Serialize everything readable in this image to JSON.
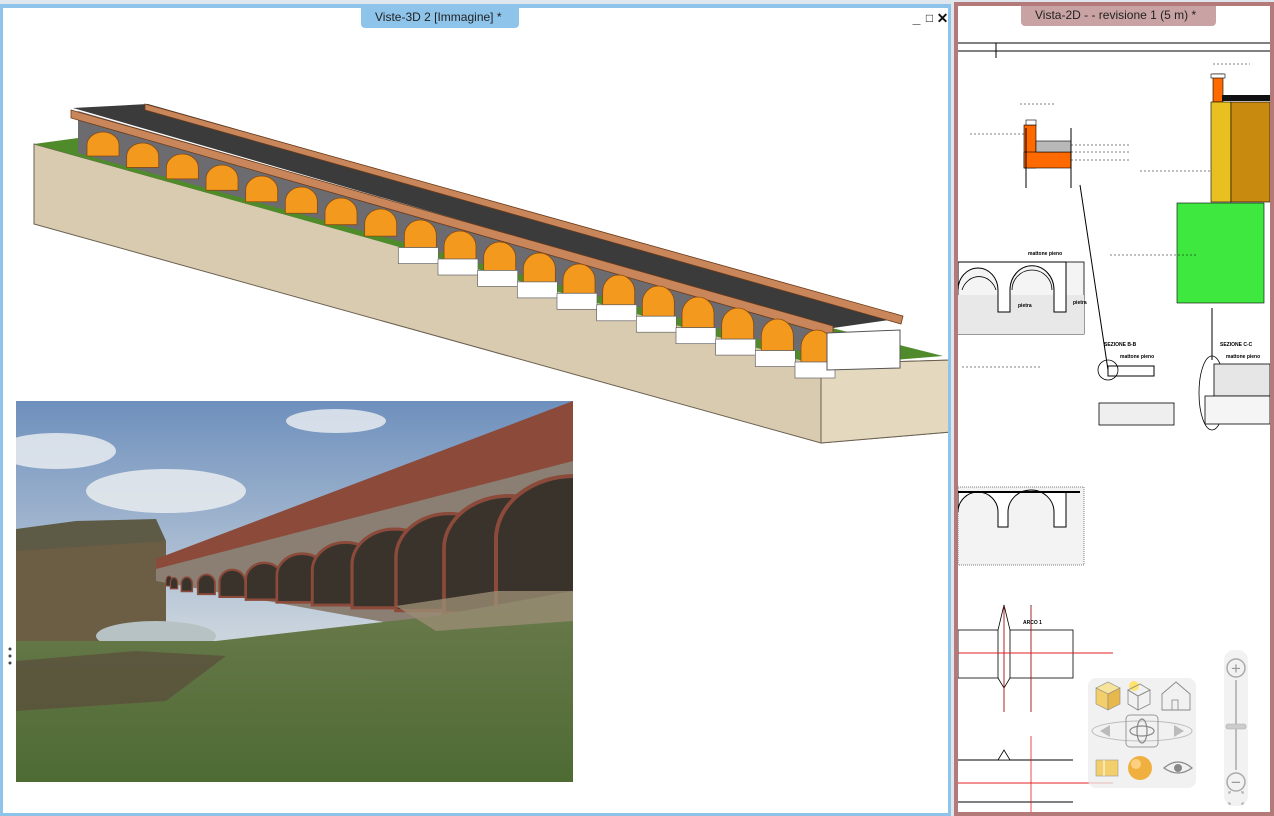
{
  "windows": {
    "view3d": {
      "title": "Viste-3D 2 [Immagine] *",
      "minimize": "_",
      "maximize": "□",
      "close": "✕"
    },
    "view2d": {
      "title": "Vista-2D -  - revisione 1 (5 m) *"
    }
  },
  "drawing_labels": {
    "mattone_pieno_1": "mattone pieno",
    "pietra_1": "pietra",
    "pietra_2": "pietra",
    "sezione_bb": "SEZIONE B-B",
    "sezione_cc": "SEZIONE C-C",
    "mattone_pieno_2": "mattone pieno",
    "mattone_pieno_3": "mattone pieno",
    "arco_1": "ARCO 1"
  },
  "nav_icons": [
    "cube-icon",
    "sun-cube-icon",
    "wire-cube-icon",
    "house-icon",
    "arrow-left-icon",
    "orbit-icon",
    "arrow-right-icon",
    "section-icon",
    "sphere-icon",
    "eye-icon"
  ],
  "zoom_controls": {
    "plus": "+",
    "minus": "−"
  },
  "colors": {
    "frame3d": "#8ec3ea",
    "frame2d": "#b47a7a",
    "arch_orange": "#f39a1e",
    "deck_brown": "#c8865a",
    "grass": "#4f8a2b",
    "ground": "#d8cbb0",
    "section_green": "#3fe83f",
    "section_yellow": "#e8c020",
    "section_ochre": "#c98a10",
    "section_orange": "#ff6a00",
    "axis_red": "#e02020"
  }
}
